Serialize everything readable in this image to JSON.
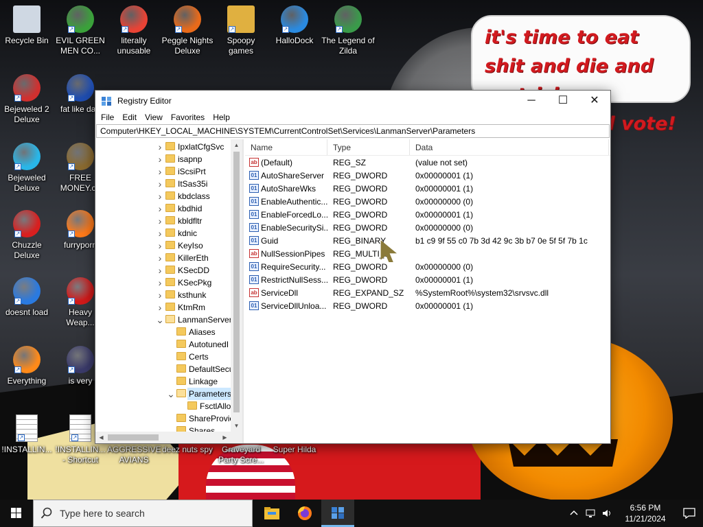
{
  "wallpaper": {
    "speech_text": "it's time to eat shit and die and go trick or treating and vote!"
  },
  "desktop_icons": [
    {
      "label": "Recycle Bin",
      "icon": "recycle-bin-icon"
    },
    {
      "label": "EVIL GREEN MEN CO...",
      "icon": "people-icon"
    },
    {
      "label": "literally unusable",
      "icon": "chrome-icon"
    },
    {
      "label": "Peggle Nights Deluxe",
      "icon": "peggle-icon"
    },
    {
      "label": "Spoopy games",
      "icon": "folder-icon"
    },
    {
      "label": "HalloDock",
      "icon": "windows-logo-icon"
    },
    {
      "label": "The Legend of Zilda",
      "icon": "zelda-icon"
    },
    {
      "label": "Bejeweled 2 Deluxe",
      "icon": "bejeweled2-icon"
    },
    {
      "label": "fat like darl",
      "icon": "mpl-icon"
    },
    {
      "label": "Bejeweled Deluxe",
      "icon": "diamond-icon"
    },
    {
      "label": "FREE MONEY.co",
      "icon": "money-bag-icon"
    },
    {
      "label": "Chuzzle Deluxe",
      "icon": "chuzzle-icon"
    },
    {
      "label": "furryporn",
      "icon": "firefox-icon"
    },
    {
      "label": "doesnt load",
      "icon": "thunderbird-icon"
    },
    {
      "label": "Heavy Weap...",
      "icon": "radiation-icon"
    },
    {
      "label": "Everything",
      "icon": "search-ring-icon"
    },
    {
      "label": "is very",
      "icon": "shield-logo-icon"
    },
    {
      "label": "!INSTALLIN...",
      "icon": "document-icon"
    },
    {
      "label": "!INSTALLIN... - Shortcut",
      "icon": "document-icon"
    },
    {
      "label": "AGGRESSIVE AVIANS",
      "icon": "app-icon"
    },
    {
      "label": "deez nuts spy",
      "icon": "app-icon"
    },
    {
      "label": "Graveyard Party Scre...",
      "icon": "app-icon"
    },
    {
      "label": "Super Hilda",
      "icon": "app-icon"
    }
  ],
  "regedit": {
    "title": "Registry Editor",
    "controls": {
      "minimize": "─",
      "maximize": "☐",
      "close": "✕"
    },
    "menu": [
      "File",
      "Edit",
      "View",
      "Favorites",
      "Help"
    ],
    "address": "Computer\\HKEY_LOCAL_MACHINE\\SYSTEM\\CurrentControlSet\\Services\\LanmanServer\\Parameters",
    "tree": [
      {
        "label": "IpxlatCfgSvc",
        "level": 0,
        "expanded": false,
        "selected": false
      },
      {
        "label": "isapnp",
        "level": 0,
        "expanded": false,
        "selected": false
      },
      {
        "label": "iScsiPrt",
        "level": 0,
        "expanded": false,
        "selected": false
      },
      {
        "label": "ItSas35i",
        "level": 0,
        "expanded": false,
        "selected": false
      },
      {
        "label": "kbdclass",
        "level": 0,
        "expanded": false,
        "selected": false
      },
      {
        "label": "kbdhid",
        "level": 0,
        "expanded": false,
        "selected": false
      },
      {
        "label": "kbldfltr",
        "level": 0,
        "expanded": false,
        "selected": false
      },
      {
        "label": "kdnic",
        "level": 0,
        "expanded": false,
        "selected": false
      },
      {
        "label": "KeyIso",
        "level": 0,
        "expanded": false,
        "selected": false
      },
      {
        "label": "KillerEth",
        "level": 0,
        "expanded": false,
        "selected": false
      },
      {
        "label": "KSecDD",
        "level": 0,
        "expanded": false,
        "selected": false
      },
      {
        "label": "KSecPkg",
        "level": 0,
        "expanded": false,
        "selected": false
      },
      {
        "label": "ksthunk",
        "level": 0,
        "expanded": false,
        "selected": false
      },
      {
        "label": "KtmRm",
        "level": 0,
        "expanded": false,
        "selected": false
      },
      {
        "label": "LanmanServer",
        "level": 0,
        "expanded": true,
        "selected": false
      },
      {
        "label": "Aliases",
        "level": 1,
        "expanded": false,
        "selected": false,
        "leaf": true
      },
      {
        "label": "AutotunedI",
        "level": 1,
        "expanded": false,
        "selected": false,
        "leaf": true
      },
      {
        "label": "Certs",
        "level": 1,
        "expanded": false,
        "selected": false,
        "leaf": true
      },
      {
        "label": "DefaultSecu",
        "level": 1,
        "expanded": false,
        "selected": false,
        "leaf": true
      },
      {
        "label": "Linkage",
        "level": 1,
        "expanded": false,
        "selected": false,
        "leaf": true
      },
      {
        "label": "Parameters",
        "level": 1,
        "expanded": true,
        "selected": true
      },
      {
        "label": "FsctlAllo",
        "level": 2,
        "expanded": false,
        "selected": false,
        "leaf": true
      },
      {
        "label": "ShareProvic",
        "level": 1,
        "expanded": false,
        "selected": false,
        "leaf": true
      },
      {
        "label": "Shares",
        "level": 1,
        "expanded": false,
        "selected": false,
        "leaf": true
      }
    ],
    "columns": [
      "Name",
      "Type",
      "Data"
    ],
    "values": [
      {
        "name": "(Default)",
        "type": "REG_SZ",
        "data": "(value not set)",
        "kind": "sz"
      },
      {
        "name": "AutoShareServer",
        "type": "REG_DWORD",
        "data": "0x00000001 (1)",
        "kind": "bin"
      },
      {
        "name": "AutoShareWks",
        "type": "REG_DWORD",
        "data": "0x00000001 (1)",
        "kind": "bin"
      },
      {
        "name": "EnableAuthentic...",
        "type": "REG_DWORD",
        "data": "0x00000000 (0)",
        "kind": "bin"
      },
      {
        "name": "EnableForcedLo...",
        "type": "REG_DWORD",
        "data": "0x00000001 (1)",
        "kind": "bin"
      },
      {
        "name": "EnableSecuritySi...",
        "type": "REG_DWORD",
        "data": "0x00000000 (0)",
        "kind": "bin"
      },
      {
        "name": "Guid",
        "type": "REG_BINARY",
        "data": "b1 c9 9f 55 c0 7b 3d 42 9c 3b b7 0e 5f 5f 7b 1c",
        "kind": "bin"
      },
      {
        "name": "NullSessionPipes",
        "type": "REG_MULTI_S",
        "data": "",
        "kind": "sz"
      },
      {
        "name": "RequireSecurity...",
        "type": "REG_DWORD",
        "data": "0x00000000 (0)",
        "kind": "bin"
      },
      {
        "name": "RestrictNullSess...",
        "type": "REG_DWORD",
        "data": "0x00000001 (1)",
        "kind": "bin"
      },
      {
        "name": "ServiceDll",
        "type": "REG_EXPAND_SZ",
        "data": "%SystemRoot%\\system32\\srvsvc.dll",
        "kind": "sz"
      },
      {
        "name": "ServiceDllUnloa...",
        "type": "REG_DWORD",
        "data": "0x00000001 (1)",
        "kind": "bin"
      }
    ]
  },
  "taskbar": {
    "search_placeholder": "Type here to search",
    "apps": [
      {
        "name": "file-explorer-icon",
        "active": false
      },
      {
        "name": "firefox-icon",
        "active": false
      },
      {
        "name": "registry-editor-icon",
        "active": true
      }
    ],
    "time": "6:56 PM",
    "date": "11/21/2024"
  },
  "colors": {
    "accent": "#76b9ed",
    "selection": "#cce8ff",
    "speech_red": "#d21a1f"
  }
}
